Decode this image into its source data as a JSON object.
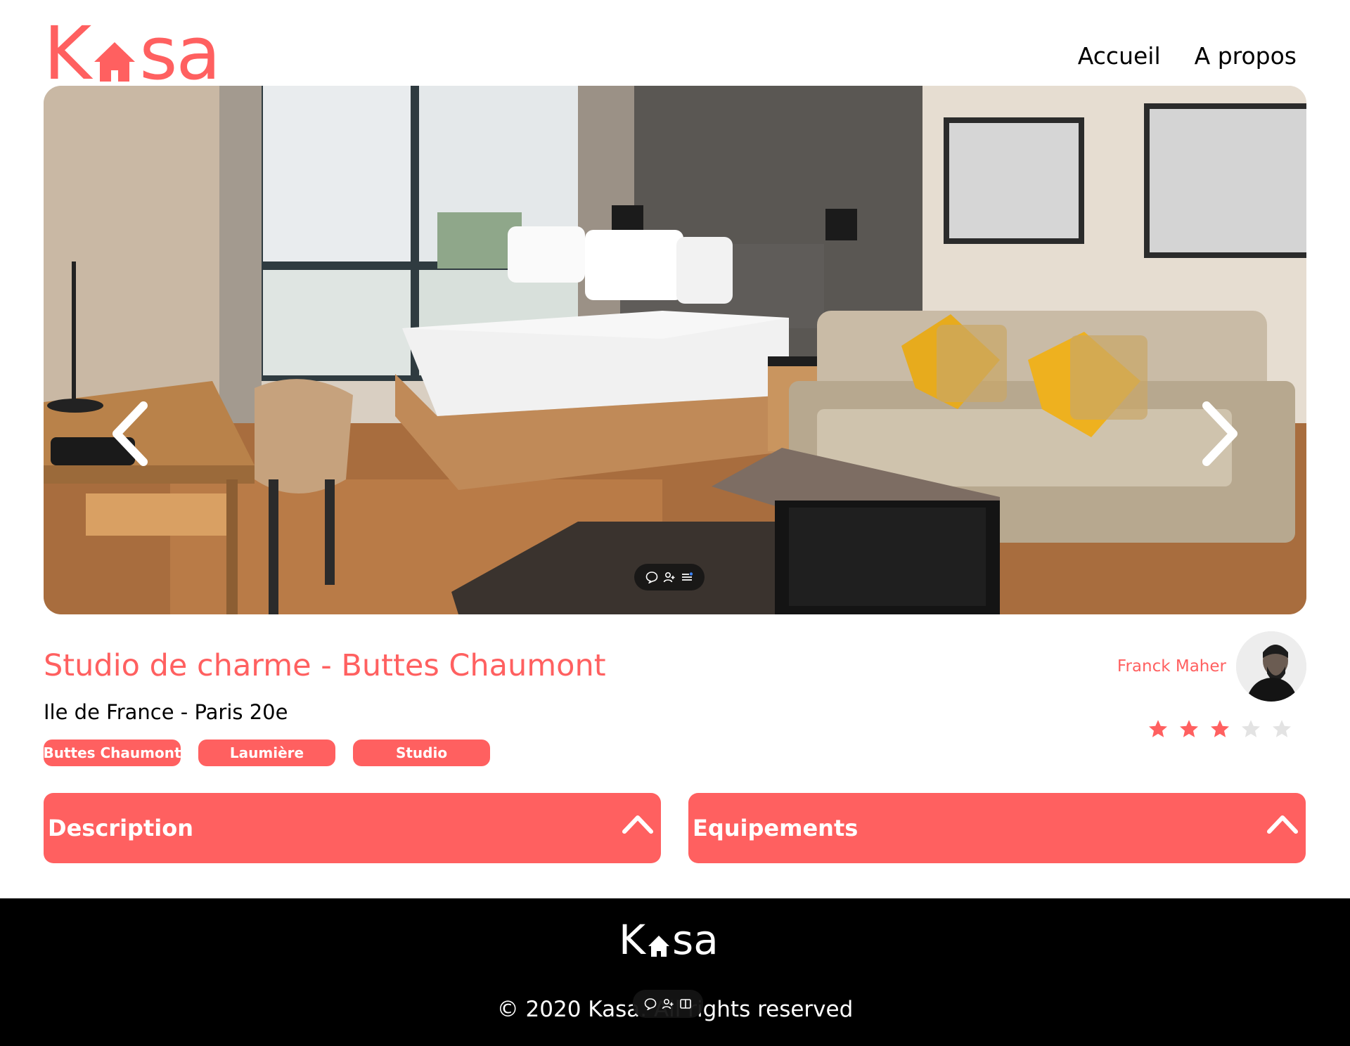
{
  "header": {
    "logo_left": "K",
    "logo_right": "sa",
    "nav": [
      {
        "label": "Accueil"
      },
      {
        "label": "A propos"
      }
    ]
  },
  "carousel": {
    "prev_icon": "chevron-left-icon",
    "next_icon": "chevron-right-icon"
  },
  "listing": {
    "title": "Studio de charme - Buttes Chaumont",
    "location": "Ile de France - Paris 20e",
    "tags": [
      "Buttes Chaumont",
      "Laumière",
      "Studio"
    ],
    "host": {
      "name": "Franck Maher"
    },
    "rating": 3,
    "rating_max": 5
  },
  "collapses": {
    "description": {
      "label": "Description",
      "icon": "chevron-up-icon"
    },
    "equipments": {
      "label": "Equipements",
      "icon": "chevron-up-icon"
    }
  },
  "footer": {
    "logo_left": "K",
    "logo_right": "sa",
    "copyright": "© 2020 Kasa. All rights reserved"
  },
  "colors": {
    "brand": "#FF6060",
    "footer_bg": "#000000",
    "star_empty": "#E3E3E3"
  }
}
